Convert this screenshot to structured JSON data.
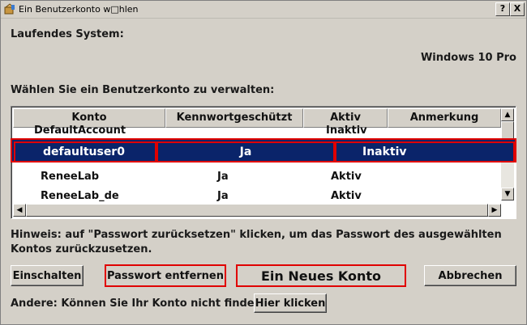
{
  "window": {
    "title": "Ein Benutzerkonto w\u0000hlen",
    "title_display": "Ein Benutzerkonto w□hlen",
    "help_label": "?",
    "close_label": "X"
  },
  "system": {
    "label": "Laufendes System:",
    "value": "Windows 10 Pro"
  },
  "accounts": {
    "heading": "Wählen Sie ein Benutzerkonto zu verwalten:",
    "columns": [
      "Konto",
      "Kennwortgeschützt",
      "Aktiv",
      "Anmerkung"
    ],
    "rows": [
      {
        "konto": "DefaultAccount",
        "kennwort": "",
        "aktiv": "Inaktiv",
        "anmerkung": ""
      },
      {
        "konto": "defaultuser0",
        "kennwort": "Ja",
        "aktiv": "Inaktiv",
        "anmerkung": "",
        "selected": true
      },
      {
        "konto": "ReneeLab",
        "kennwort": "Ja",
        "aktiv": "Aktiv",
        "anmerkung": ""
      },
      {
        "konto": "ReneeLab_de",
        "kennwort": "Ja",
        "aktiv": "Aktiv",
        "anmerkung": ""
      }
    ]
  },
  "hint": "Hinweis: auf \"Passwort zurücksetzen\" klicken, um das Passwort des ausgewählten Kontos zurückzusetzen.",
  "buttons": {
    "enable": "Einschalten",
    "remove_password": "Passwort entfernen",
    "new_account": "Ein Neues Konto",
    "cancel": "Abbrechen"
  },
  "other": {
    "label": "Andere: Können Sie Ihr Konto nicht finden?",
    "link_button": "Hier klicken"
  },
  "colors": {
    "selection": "#0a246a",
    "highlight_border": "#e00000",
    "window_bg": "#d4d0c8"
  }
}
